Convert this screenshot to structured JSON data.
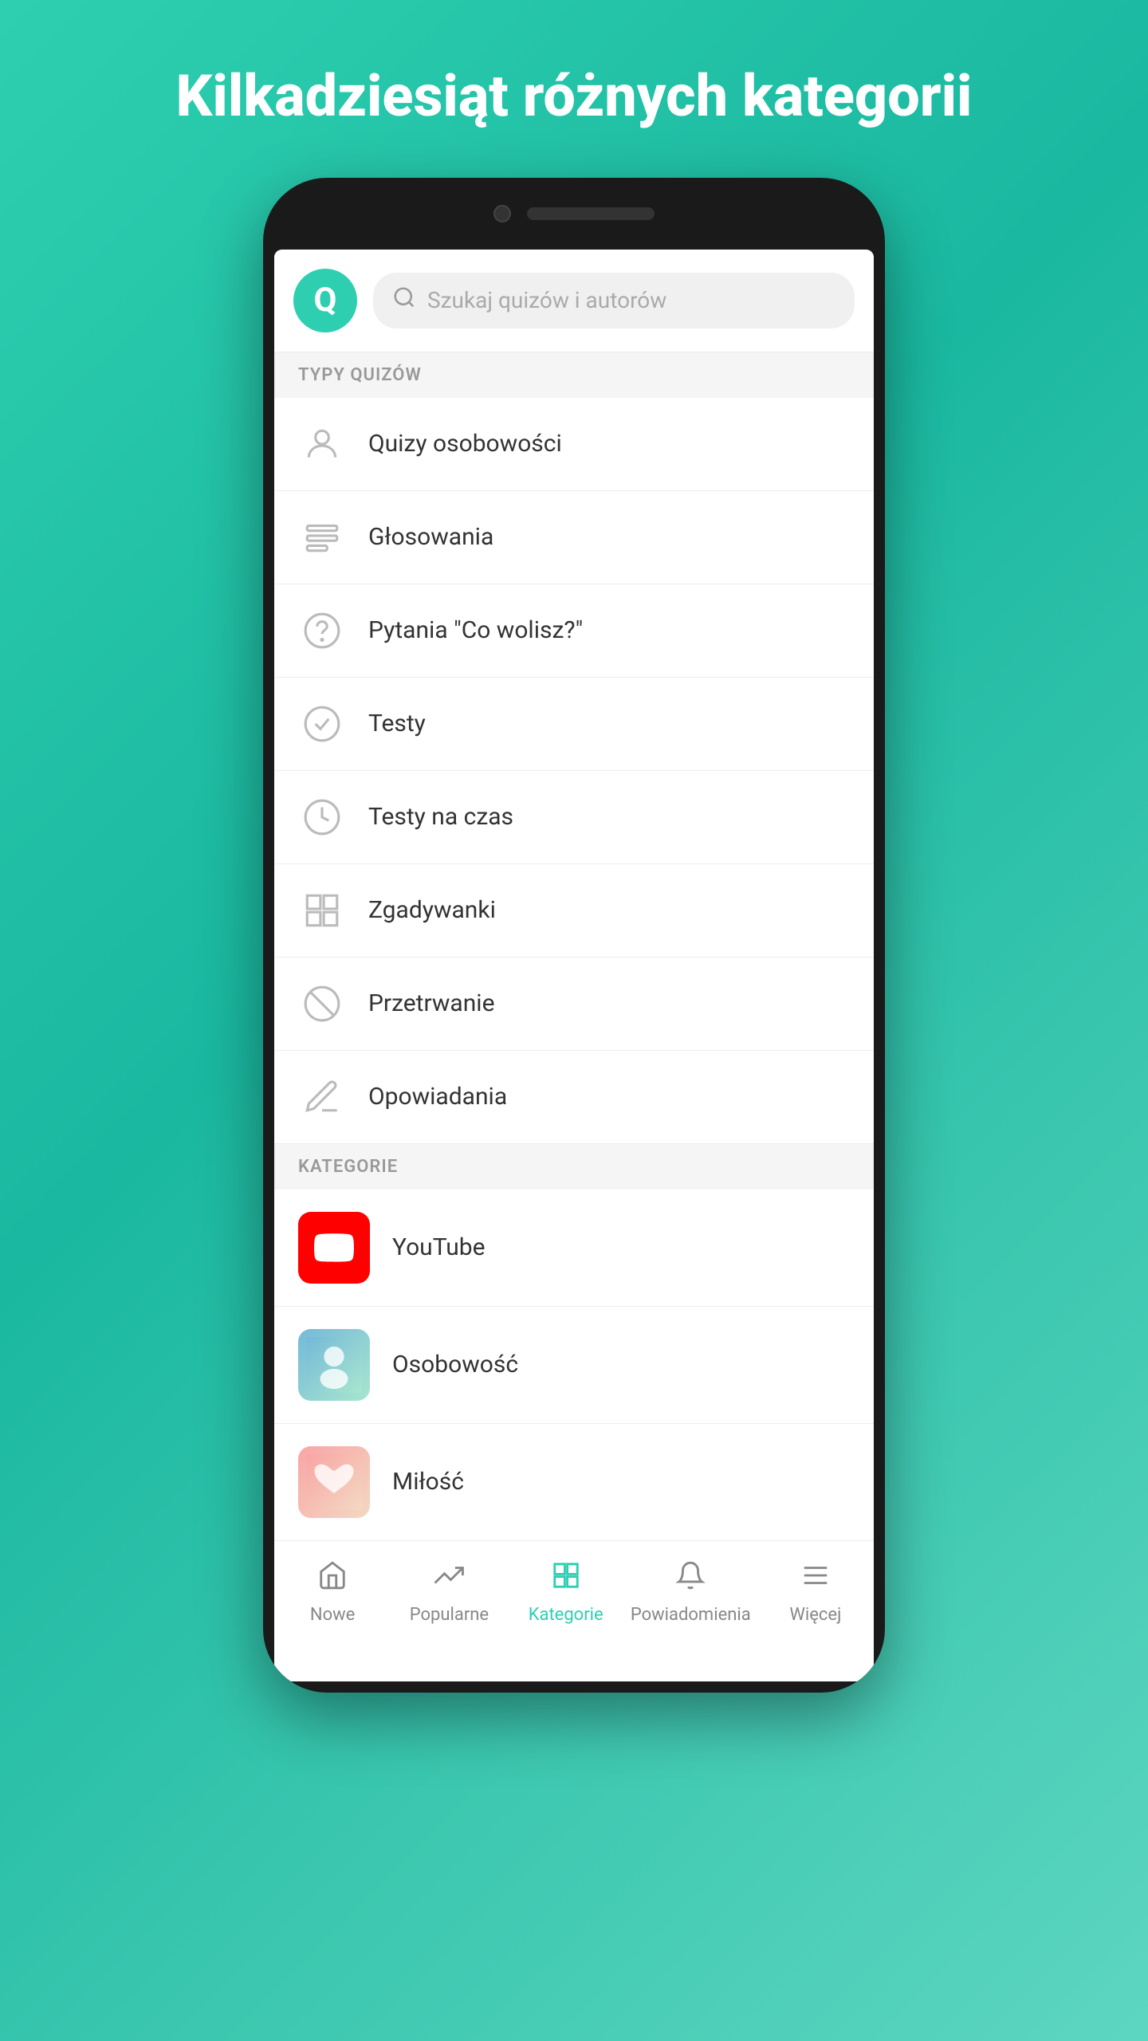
{
  "page": {
    "title": "Kilkadziesiąt różnych kategorii",
    "background_gradient_start": "#2ecfb0",
    "background_gradient_end": "#5dd6c0"
  },
  "header": {
    "logo_letter": "Q",
    "search_placeholder": "Szukaj quizów i autorów"
  },
  "sections": [
    {
      "id": "quiz_types",
      "label": "TYPY QUIZÓW",
      "items": [
        {
          "id": "personality",
          "icon": "person",
          "label": "Quizy osobowości"
        },
        {
          "id": "voting",
          "icon": "list",
          "label": "Głosowania"
        },
        {
          "id": "would_you_rather",
          "icon": "question",
          "label": "Pytania \"Co wolisz?\""
        },
        {
          "id": "tests",
          "icon": "check",
          "label": "Testy"
        },
        {
          "id": "timed_tests",
          "icon": "clock",
          "label": "Testy na czas"
        },
        {
          "id": "puzzles",
          "icon": "grid",
          "label": "Zgadywanki"
        },
        {
          "id": "survival",
          "icon": "compass",
          "label": "Przetrwanie"
        },
        {
          "id": "stories",
          "icon": "pen",
          "label": "Opowiadania"
        }
      ]
    },
    {
      "id": "categories",
      "label": "KATEGORIE",
      "items": [
        {
          "id": "youtube",
          "icon": "youtube",
          "label": "YouTube"
        },
        {
          "id": "osobowosc",
          "icon": "osobowosc",
          "label": "Osobowość"
        },
        {
          "id": "milosc",
          "icon": "milosc",
          "label": "Miłość"
        }
      ]
    }
  ],
  "bottom_nav": [
    {
      "id": "nowe",
      "icon": "home",
      "label": "Nowe",
      "active": false
    },
    {
      "id": "popularne",
      "icon": "trending",
      "label": "Popularne",
      "active": false
    },
    {
      "id": "kategorie",
      "icon": "grid",
      "label": "Kategorie",
      "active": true
    },
    {
      "id": "powiadomienia",
      "icon": "bell",
      "label": "Powiadomienia",
      "active": false
    },
    {
      "id": "wiecej",
      "icon": "menu",
      "label": "Więcej",
      "active": false
    }
  ]
}
